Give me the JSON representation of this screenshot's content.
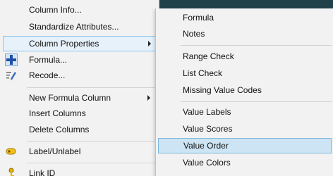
{
  "main_menu": {
    "items": [
      {
        "label": "Column Info..."
      },
      {
        "label": "Standardize Attributes..."
      },
      {
        "label": "Column Properties"
      },
      {
        "label": "Formula..."
      },
      {
        "label": "Recode..."
      },
      {
        "label": "New Formula Column"
      },
      {
        "label": "Insert Columns"
      },
      {
        "label": "Delete Columns"
      },
      {
        "label": "Label/Unlabel"
      },
      {
        "label": "Link ID"
      }
    ]
  },
  "submenu": {
    "items": [
      {
        "label": "Formula"
      },
      {
        "label": "Notes"
      },
      {
        "label": "Range Check"
      },
      {
        "label": "List Check"
      },
      {
        "label": "Missing Value Codes"
      },
      {
        "label": "Value Labels"
      },
      {
        "label": "Value Scores"
      },
      {
        "label": "Value Order"
      },
      {
        "label": "Value Colors"
      }
    ]
  },
  "icons": {
    "formula": "plus-cross-icon",
    "recode": "pencil-list-icon",
    "label_unlabel": "tag-label-icon",
    "link_id": "key-icon"
  },
  "colors": {
    "menu_bg": "#f2f2f2",
    "highlight_bg": "#cce4f4",
    "highlight_border": "#7db7de",
    "plus_blue": "#1f4fa8",
    "window_dark": "#20404a"
  }
}
